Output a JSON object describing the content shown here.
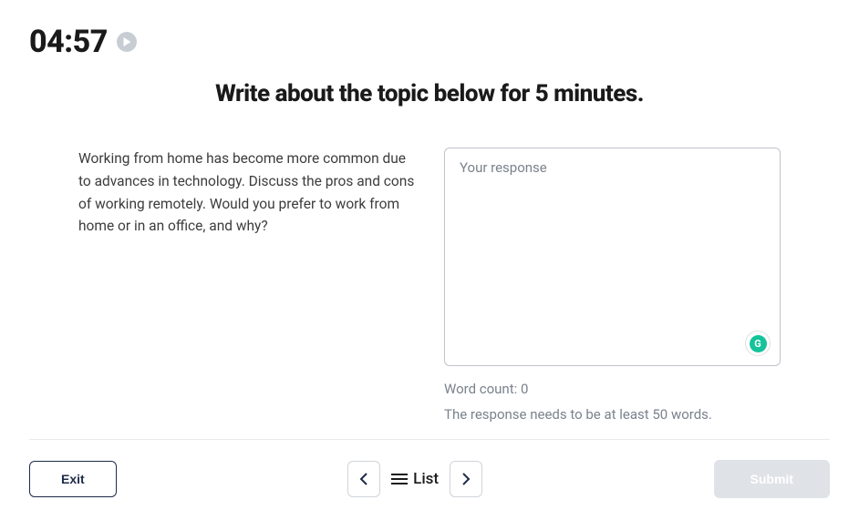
{
  "timer": "04:57",
  "instruction": "Write about the topic below for 5 minutes.",
  "prompt_text": "Working from home has become more common due to advances in technology. Discuss the pros and cons of working remotely. Would you prefer to work from home or in an office, and why?",
  "response": {
    "placeholder": "Your response",
    "value": ""
  },
  "word_count_label": "Word count: 0",
  "requirement_text": "The response needs to be at least 50 words.",
  "footer": {
    "exit_label": "Exit",
    "list_label": "List",
    "submit_label": "Submit"
  }
}
